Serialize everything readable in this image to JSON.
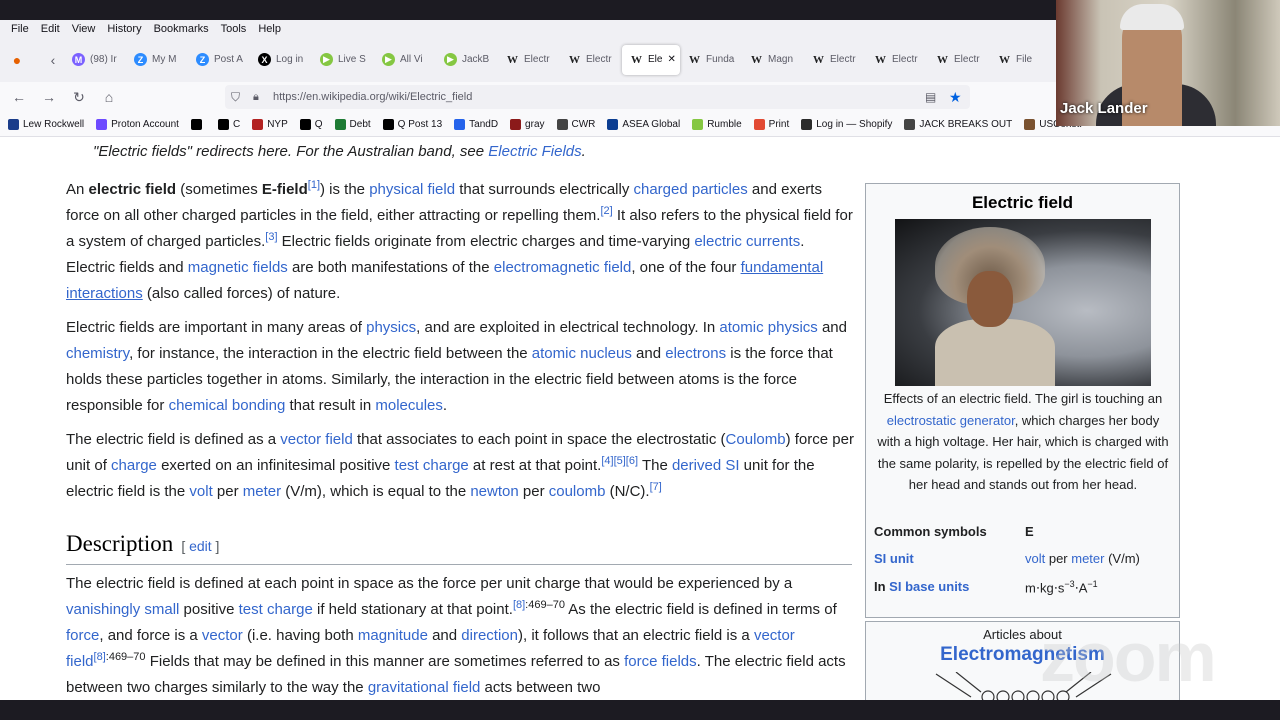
{
  "menubar": [
    "File",
    "Edit",
    "View",
    "History",
    "Bookmarks",
    "Tools",
    "Help"
  ],
  "tabs": [
    {
      "label": "(98) Ir",
      "icon": "mail-icon",
      "color": "#7b61ff"
    },
    {
      "label": "My M",
      "icon": "z-icon",
      "color": "#2d8cff"
    },
    {
      "label": "Post A",
      "icon": "z-icon",
      "color": "#2d8cff"
    },
    {
      "label": "Log in",
      "icon": "x-icon",
      "color": "#000000"
    },
    {
      "label": "Live S",
      "icon": "rumble-icon",
      "color": "#85c742"
    },
    {
      "label": "All Vi",
      "icon": "rumble-icon",
      "color": "#85c742"
    },
    {
      "label": "JackB",
      "icon": "rumble-icon",
      "color": "#85c742"
    },
    {
      "label": "Electr",
      "icon": "wikipedia-icon",
      "color": "#333333"
    },
    {
      "label": "Electr",
      "icon": "wikipedia-icon",
      "color": "#333333"
    },
    {
      "label": "Ele",
      "icon": "wikipedia-icon",
      "color": "#333333",
      "active": true
    },
    {
      "label": "Funda",
      "icon": "wikipedia-icon",
      "color": "#333333"
    },
    {
      "label": "Magn",
      "icon": "wikipedia-icon",
      "color": "#333333"
    },
    {
      "label": "Electr",
      "icon": "wikipedia-icon",
      "color": "#333333"
    },
    {
      "label": "Electr",
      "icon": "wikipedia-icon",
      "color": "#333333"
    },
    {
      "label": "Electr",
      "icon": "wikipedia-icon",
      "color": "#333333"
    },
    {
      "label": "File",
      "icon": "wikipedia-icon",
      "color": "#333333"
    }
  ],
  "url": "https://en.wikipedia.org/wiki/Electric_field",
  "bookmarks": [
    "Lew Rockwell",
    "Proton Account",
    "",
    "C",
    "NYP",
    "Q",
    "Debt",
    "Q Post 13",
    "TandD",
    "gray",
    "CWR",
    "ASEA Global",
    "Rumble",
    "Print",
    "Log in — Shopify",
    "JACK BREAKS OUT",
    "USConst."
  ],
  "article": {
    "hatnote_pre": "\"Electric fields\" redirects here. For the Australian band, see ",
    "hatnote_link": "Electric Fields",
    "hatnote_post": ".",
    "p1": {
      "t1": "An ",
      "b1": "electric field",
      "t2": " (sometimes ",
      "b2": "E-field",
      "r1": "[1]",
      "t3": ") is the ",
      "l1": "physical field",
      "t4": " that surrounds electrically ",
      "l2": "charged particles",
      "t5": " and exerts force on all other charged particles in the field, either attracting or repelling them.",
      "r2": "[2]",
      "t6": " It also refers to the physical field for a system of charged particles.",
      "r3": "[3]",
      "t7": " Electric fields originate from electric charges and time-varying ",
      "l3": "electric currents",
      "t8": ". Electric fields and ",
      "l4": "magnetic fields",
      "t9": " are both manifestations of the ",
      "l5": "electromagnetic field",
      "t10": ", one of the four ",
      "l6": "fundamental interactions",
      "t11": " (also called forces) of nature."
    },
    "p2": {
      "t1": "Electric fields are important in many areas of ",
      "l1": "physics",
      "t2": ", and are exploited in electrical technology. In ",
      "l2": "atomic physics",
      "t3": " and ",
      "l3": "chemistry",
      "t4": ", for instance, the interaction in the electric field between the ",
      "l4": "atomic nucleus",
      "t5": " and ",
      "l5": "electrons",
      "t6": " is the force that holds these particles together in atoms. Similarly, the interaction in the electric field between atoms is the force responsible for ",
      "l6": "chemical bonding",
      "t7": " that result in ",
      "l7": "molecules",
      "t8": "."
    },
    "p3": {
      "t1": "The electric field is defined as a ",
      "l1": "vector field",
      "t2": " that associates to each point in space the electrostatic (",
      "l2": "Coulomb",
      "t3": ") force per unit of ",
      "l3": "charge",
      "t4": " exerted on an infinitesimal positive ",
      "l4": "test charge",
      "t5": " at rest at that point.",
      "r1": "[4][5][6]",
      "t6": " The ",
      "l5": "derived SI",
      "t7": " unit for the electric field is the ",
      "l6": "volt",
      "t8": " per ",
      "l7": "meter",
      "t9": " (V/m), which is equal to the ",
      "l8": "newton",
      "t10": " per ",
      "l9": "coulomb",
      "t11": " (N/C).",
      "r2": "[7]"
    },
    "section_title": "Description",
    "edit_open": "[ ",
    "edit_label": "edit",
    "edit_close": " ]",
    "p4": {
      "t1": "The electric field is defined at each point in space as the force per unit charge that would be experienced by a ",
      "l1": "vanishingly small",
      "t2": " positive ",
      "l2": "test charge",
      "t3": " if held stationary at that point.",
      "r1": "[8]",
      "r1p": ":469–70",
      "t4": " As the electric field is defined in terms of ",
      "l3": "force",
      "t5": ", and force is a ",
      "l4": "vector",
      "t6": " (i.e. having both ",
      "l5": "magnitude",
      "t7": " and ",
      "l6": "direction",
      "t8": "), it follows that an electric field is a ",
      "l7": "vector field",
      "r2": "[8]",
      "r2p": ":469–70",
      "t9": " Fields that may be defined in this manner are sometimes referred to as ",
      "l8": "force fields",
      "t10": ". The electric field acts between two charges similarly to the way the ",
      "l9": "gravitational field",
      "t11": " acts between two"
    }
  },
  "infobox": {
    "title": "Electric field",
    "caption_t1": "Effects of an electric field. The girl is touching an ",
    "caption_link": "electrostatic generator",
    "caption_t2": ", which charges her body with a high voltage. Her hair, which is charged with the same polarity, is repelled by the electric field of her head and stands out from her head.",
    "row1_label": "Common symbols",
    "row1_value": "E",
    "row2_label": "SI unit",
    "row2_v1": "volt",
    "row2_v2": " per ",
    "row2_v3": "meter",
    "row2_v4": " (V/m)",
    "row3_pre": "In ",
    "row3_label": "SI base units",
    "row3_value": "m⋅kg⋅s",
    "row3_exp1": "−3",
    "row3_mid": "⋅A",
    "row3_exp2": "−1"
  },
  "sidebox": {
    "head": "Articles about",
    "title": "Electromagnetism"
  },
  "webcam": {
    "name": "Jack Lander"
  },
  "watermark": "zoom"
}
